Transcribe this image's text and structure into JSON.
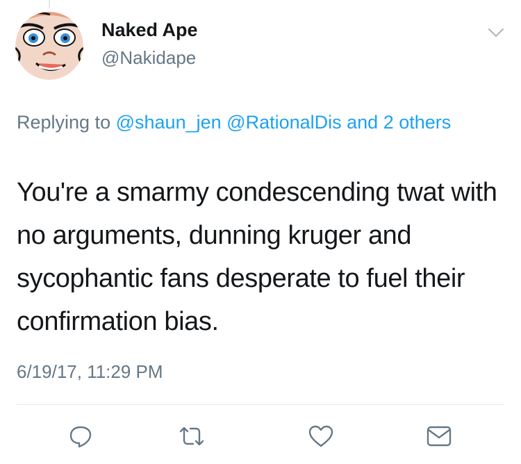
{
  "author": {
    "display_name": "Naked Ape",
    "handle": "@Nakidape",
    "avatar_icon": "cartoon-ape-face-avatar"
  },
  "reply_context": {
    "prefix": "Replying to",
    "mention_1": "@shaun_jen",
    "mention_2": "@RationalDis",
    "others": "and 2 others"
  },
  "tweet": {
    "text": "You're a smarmy condescending twat with no arguments, dunning kruger and sycophantic fans desperate to fuel their confirmation bias.",
    "timestamp": "6/19/17, 11:29 PM"
  },
  "actions": [
    {
      "icon": "reply-icon"
    },
    {
      "icon": "retweet-icon"
    },
    {
      "icon": "like-heart-icon"
    },
    {
      "icon": "direct-message-icon"
    }
  ],
  "colors": {
    "link": "#1da1f2",
    "secondary_text": "#657786",
    "primary_text": "#14171a",
    "divider": "#e1e8ed"
  }
}
